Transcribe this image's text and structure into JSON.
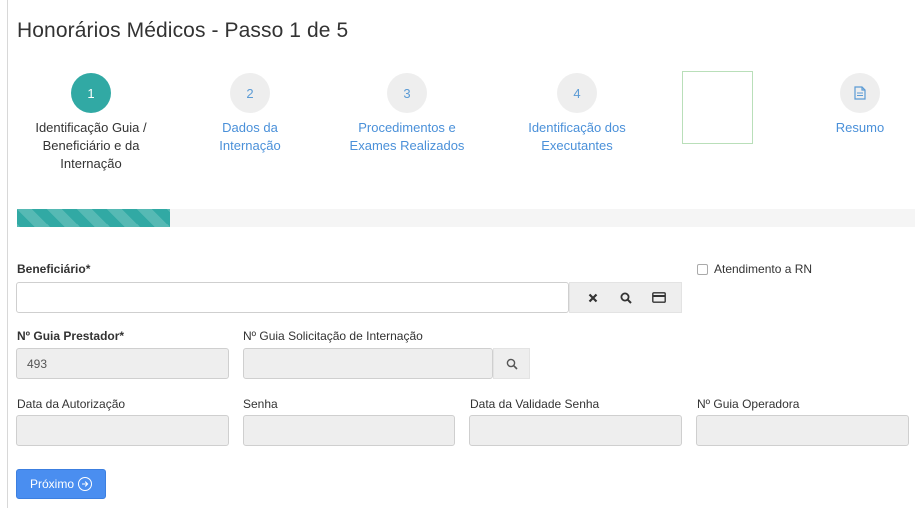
{
  "title": "Honorários Médicos - Passo 1 de 5",
  "steps": [
    {
      "number": "1",
      "label_lines": [
        "Identificação Guia /",
        "Beneficiário e da",
        "Internação"
      ]
    },
    {
      "number": "2",
      "label_lines": [
        "Dados da",
        "Internação"
      ]
    },
    {
      "number": "3",
      "label_lines": [
        "Procedimentos e",
        "Exames Realizados"
      ]
    },
    {
      "number": "4",
      "label_lines": [
        "Identificação dos",
        "Executantes"
      ]
    },
    {
      "number": "",
      "icon": "document-icon",
      "label_lines": [
        "Resumo"
      ]
    }
  ],
  "progress": {
    "percent": 17,
    "color": "#31a9a4"
  },
  "form": {
    "beneficiario": {
      "label": "Beneficiário*",
      "value": "",
      "icons": [
        "clear-icon",
        "search-icon",
        "card-icon"
      ]
    },
    "atendimento_rn": {
      "label": "Atendimento a RN",
      "checked": false
    },
    "guia_prestador": {
      "label": "Nº Guia Prestador*",
      "value": "493"
    },
    "guia_solicitacao": {
      "label": "Nº Guia Solicitação de Internação",
      "value": "",
      "icon": "search-icon"
    },
    "data_autorizacao": {
      "label": "Data da Autorização",
      "value": ""
    },
    "senha": {
      "label": "Senha",
      "value": ""
    },
    "data_validade_senha": {
      "label": "Data da Validade Senha",
      "value": ""
    },
    "guia_operadora": {
      "label": "Nº Guia Operadora",
      "value": ""
    }
  },
  "buttons": {
    "next": "Próximo"
  },
  "colors": {
    "accent": "#31a9a4",
    "link": "#4a90d9",
    "primary_button": "#4a8ef0"
  }
}
